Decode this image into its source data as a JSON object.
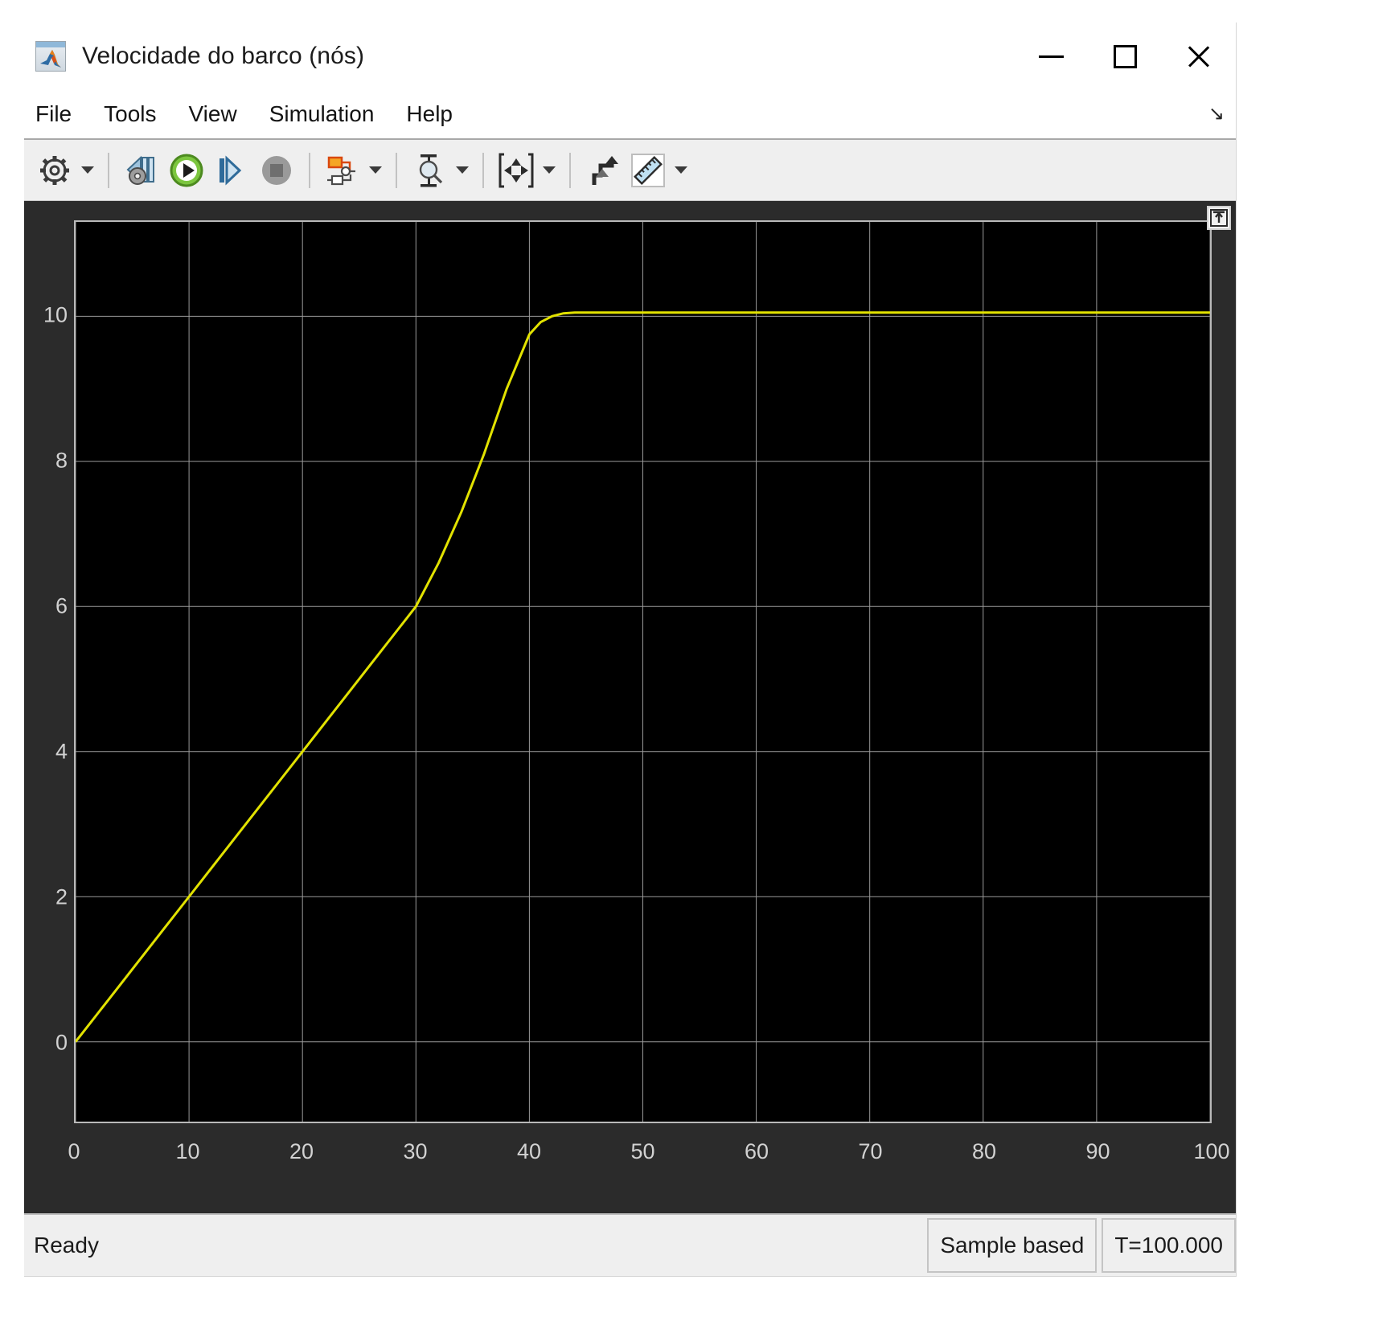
{
  "window": {
    "title": "Velocidade do barco (nós)",
    "app_icon": "matlab-scope-icon",
    "controls": {
      "minimize": "minimize-button",
      "maximize": "maximize-button",
      "close": "close-button"
    }
  },
  "menubar": {
    "items": [
      {
        "label": "File"
      },
      {
        "label": "Tools"
      },
      {
        "label": "View"
      },
      {
        "label": "Simulation"
      },
      {
        "label": "Help"
      }
    ],
    "expand_glyph": "↘"
  },
  "toolbar": {
    "buttons": [
      {
        "name": "configuration-properties-icon",
        "tooltip": "Configuration Properties",
        "has_caret": true
      },
      {
        "name": "run-back-to-start-icon",
        "tooltip": "Rewind",
        "has_caret": false
      },
      {
        "name": "run-play-icon",
        "tooltip": "Run",
        "has_caret": false
      },
      {
        "name": "step-forward-icon",
        "tooltip": "Step Forward",
        "has_caret": false
      },
      {
        "name": "stop-icon",
        "tooltip": "Stop",
        "has_caret": false
      },
      {
        "name": "block-diagram-icon",
        "tooltip": "Simulink Block Diagram",
        "has_caret": true
      },
      {
        "name": "cursor-measurements-icon",
        "tooltip": "Cursor Measurements",
        "has_caret": true
      },
      {
        "name": "fit-to-view-icon",
        "tooltip": "Scale Axes Limits",
        "has_caret": true
      },
      {
        "name": "highlight-signal-icon",
        "tooltip": "Highlight Signal in Model",
        "has_caret": false
      },
      {
        "name": "measurements-ruler-icon",
        "tooltip": "Measurements",
        "has_caret": true
      }
    ]
  },
  "plot": {
    "pin_icon": "dock-pin-icon",
    "background_color": "#000000",
    "panel_color": "#2b2b2b",
    "grid_color": "#9a9a9a",
    "line_color": "#e2e200"
  },
  "statusbar": {
    "status": "Ready",
    "sample_mode": "Sample based",
    "time": "T=100.000"
  },
  "chart_data": {
    "type": "line",
    "title": "Velocidade do barco (nós)",
    "xlabel": "",
    "ylabel": "",
    "xlim": [
      0,
      100
    ],
    "ylim": [
      -1.1,
      11.3
    ],
    "xticks": [
      0,
      10,
      20,
      30,
      40,
      50,
      60,
      70,
      80,
      90,
      100
    ],
    "yticks": [
      0,
      2,
      4,
      6,
      8,
      10
    ],
    "xticklabels": [
      "0",
      "10",
      "20",
      "30",
      "40",
      "50",
      "60",
      "70",
      "80",
      "90",
      "100"
    ],
    "yticklabels": [
      "0",
      "2",
      "4",
      "6",
      "8",
      "10"
    ],
    "grid": true,
    "legend": null,
    "series": [
      {
        "name": "Velocidade do barco",
        "color": "#e2e200",
        "x": [
          0,
          2,
          4,
          6,
          8,
          10,
          12,
          14,
          16,
          18,
          20,
          22,
          24,
          26,
          28,
          30,
          32,
          34,
          36,
          38,
          40,
          41,
          42,
          43,
          44,
          46,
          50,
          60,
          70,
          80,
          90,
          100
        ],
        "y": [
          0.0,
          0.4,
          0.8,
          1.2,
          1.6,
          2.0,
          2.4,
          2.8,
          3.2,
          3.6,
          4.0,
          4.4,
          4.8,
          5.2,
          5.6,
          6.0,
          6.6,
          7.3,
          8.1,
          9.0,
          9.75,
          9.92,
          10.0,
          10.04,
          10.05,
          10.05,
          10.05,
          10.05,
          10.05,
          10.05,
          10.05,
          10.05
        ]
      }
    ]
  }
}
